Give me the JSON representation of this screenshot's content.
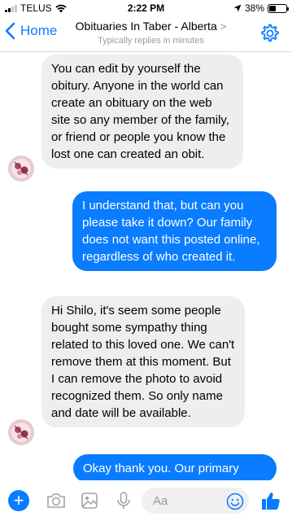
{
  "status_bar": {
    "carrier": "TELUS",
    "time": "2:22 PM",
    "battery": "38%",
    "battery_level": 0.38,
    "signal_bars": 2,
    "icons": [
      "wifi-icon",
      "location-arrow-icon"
    ]
  },
  "header": {
    "back_label": "Home",
    "title": "Obituaries In Taber - Alberta",
    "title_chevron": ">",
    "subtitle": "Typically replies in minutes",
    "icons": [
      "chevron-left-icon",
      "gear-icon"
    ]
  },
  "messages": [
    {
      "direction": "incoming",
      "text": "You can edit by yourself the obitury. Anyone in the world can create an obituary on the web site so any member of the family, or friend or people you know the lost one can created an obit."
    },
    {
      "direction": "outgoing",
      "text": "I understand that, but can you please take it down? Our family does not want this posted online, regardless of who created it."
    },
    {
      "direction": "incoming",
      "text": "Hi Shilo, it's seem some people bought some sympathy thing related to this loved one. We can't remove them at this moment. But I can remove the photo to avoid recognized them. So only name and date will be available."
    },
    {
      "direction": "outgoing",
      "text": "Okay thank you. Our primary"
    }
  ],
  "composer": {
    "placeholder": "Aa",
    "icons": [
      "plus-icon",
      "camera-icon",
      "photo-icon",
      "microphone-icon",
      "emoji-icon",
      "thumbs-up-icon"
    ]
  },
  "colors": {
    "accent": "#0a7cff",
    "incoming_bubble": "#eeeeef",
    "subtitle_gray": "#9a9a9a"
  }
}
